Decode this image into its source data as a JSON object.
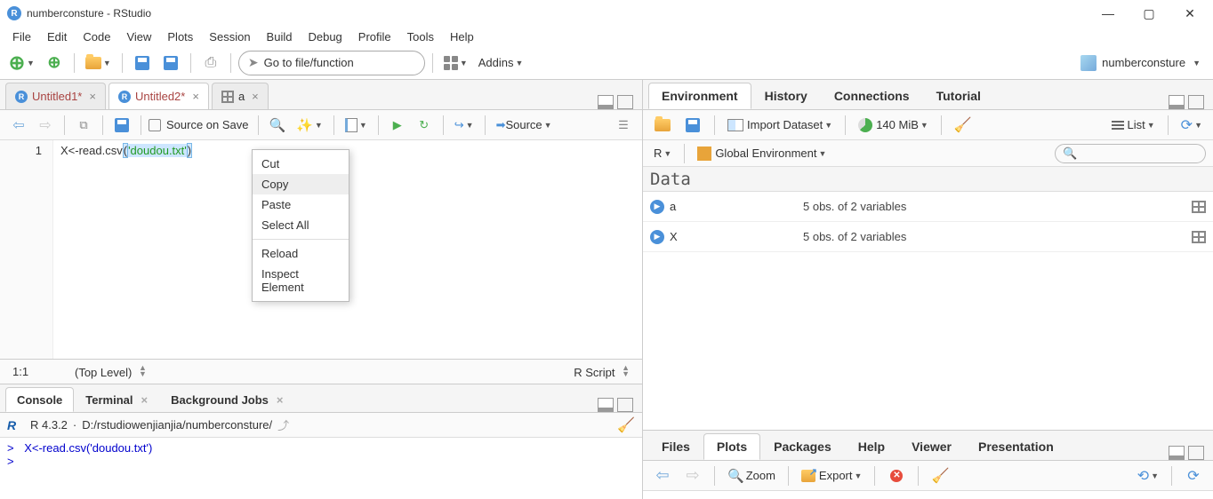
{
  "window": {
    "title": "numberconsture - RStudio"
  },
  "menubar": [
    "File",
    "Edit",
    "Code",
    "View",
    "Plots",
    "Session",
    "Build",
    "Debug",
    "Profile",
    "Tools",
    "Help"
  ],
  "toolbar": {
    "goto_placeholder": "Go to file/function",
    "addins_label": "Addins",
    "project_name": "numberconsture"
  },
  "source_tabs": [
    {
      "label": "Untitled1*",
      "modified": true,
      "type": "r"
    },
    {
      "label": "Untitled2*",
      "modified": true,
      "type": "r",
      "active": true
    },
    {
      "label": "a",
      "modified": false,
      "type": "table"
    }
  ],
  "editor_toolbar": {
    "source_on_save": "Source on Save",
    "source_btn": "Source"
  },
  "editor": {
    "line_number": "1",
    "code_prefix": "X<-read.csv",
    "code_open": "(",
    "code_str": "'doudou.txt'",
    "code_close": ")"
  },
  "context_menu": {
    "cut": "Cut",
    "copy": "Copy",
    "paste": "Paste",
    "select_all": "Select All",
    "reload": "Reload",
    "inspect": "Inspect Element"
  },
  "statusbar": {
    "pos": "1:1",
    "scope": "(Top Level)",
    "lang": "R Script"
  },
  "console_tabs": {
    "console": "Console",
    "terminal": "Terminal",
    "bg": "Background Jobs"
  },
  "console": {
    "version": "R 4.3.2",
    "dot": "·",
    "path": "D:/rstudiowenjianjia/numberconsture/",
    "prompt": ">",
    "line": "X<-read.csv('doudou.txt')",
    "prompt2": ">"
  },
  "env_tabs": {
    "environment": "Environment",
    "history": "History",
    "connections": "Connections",
    "tutorial": "Tutorial"
  },
  "env_toolbar": {
    "import": "Import Dataset",
    "memory": "140 MiB",
    "list": "List"
  },
  "env_toolbar2": {
    "r": "R",
    "global": "Global Environment"
  },
  "env_search_placeholder": "",
  "env_section": "Data",
  "env_data": [
    {
      "name": "a",
      "desc": "5 obs. of 2 variables"
    },
    {
      "name": "X",
      "desc": "5 obs. of 2 variables"
    }
  ],
  "plot_tabs": {
    "files": "Files",
    "plots": "Plots",
    "packages": "Packages",
    "help": "Help",
    "viewer": "Viewer",
    "presentation": "Presentation"
  },
  "plot_toolbar": {
    "zoom": "Zoom",
    "export": "Export"
  }
}
